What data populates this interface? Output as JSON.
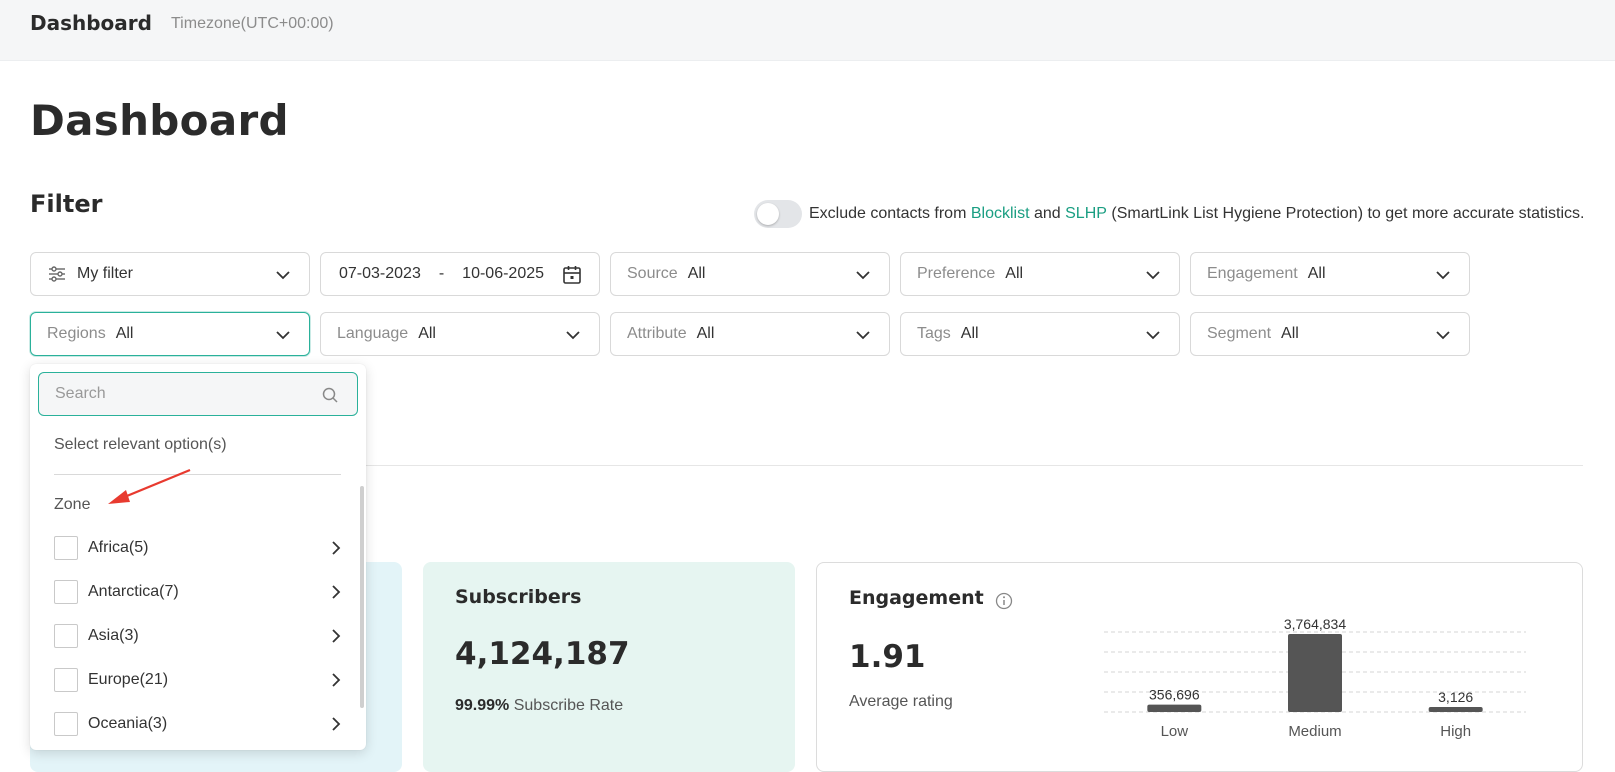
{
  "topbar": {
    "title": "Dashboard",
    "timezone": "Timezone(UTC+00:00)"
  },
  "page": {
    "title": "Dashboard"
  },
  "filter": {
    "title": "Filter",
    "exclude": {
      "prefix": "Exclude contacts from ",
      "blocklist": "Blocklist",
      "and": " and ",
      "slhp": "SLHP",
      "suffix": " (SmartLink List Hygiene Protection) to get more accurate statistics."
    },
    "my_filter": "My filter",
    "date_from": "07-03-2023",
    "date_sep": "-",
    "date_to": "10-06-2025",
    "selects": [
      {
        "label": "Source",
        "value": "All"
      },
      {
        "label": "Preference",
        "value": "All"
      },
      {
        "label": "Engagement",
        "value": "All"
      },
      {
        "label": "Regions",
        "value": "All"
      },
      {
        "label": "Language",
        "value": "All"
      },
      {
        "label": "Attribute",
        "value": "All"
      },
      {
        "label": "Tags",
        "value": "All"
      },
      {
        "label": "Segment",
        "value": "All"
      }
    ]
  },
  "regions_dropdown": {
    "search_placeholder": "Search",
    "hint": "Select relevant option(s)",
    "group": "Zone",
    "items": [
      {
        "label": "Africa(5)"
      },
      {
        "label": "Antarctica(7)"
      },
      {
        "label": "Asia(3)"
      },
      {
        "label": "Europe(21)"
      },
      {
        "label": "Oceania(3)"
      }
    ]
  },
  "subscribers": {
    "title": "Subscribers",
    "value": "4,124,187",
    "rate": "99.99%",
    "rate_label": "Subscribe Rate"
  },
  "engagement": {
    "title": "Engagement",
    "value": "1.91",
    "value_label": "Average rating"
  },
  "colors": {
    "accent": "#1a9e82",
    "bar": "#555555"
  },
  "chart_data": {
    "type": "bar",
    "categories": [
      "Low",
      "Medium",
      "High"
    ],
    "values": [
      356696,
      3764834,
      3126
    ],
    "data_labels": [
      "356,696",
      "3,764,834",
      "3,126"
    ],
    "grid": true
  }
}
